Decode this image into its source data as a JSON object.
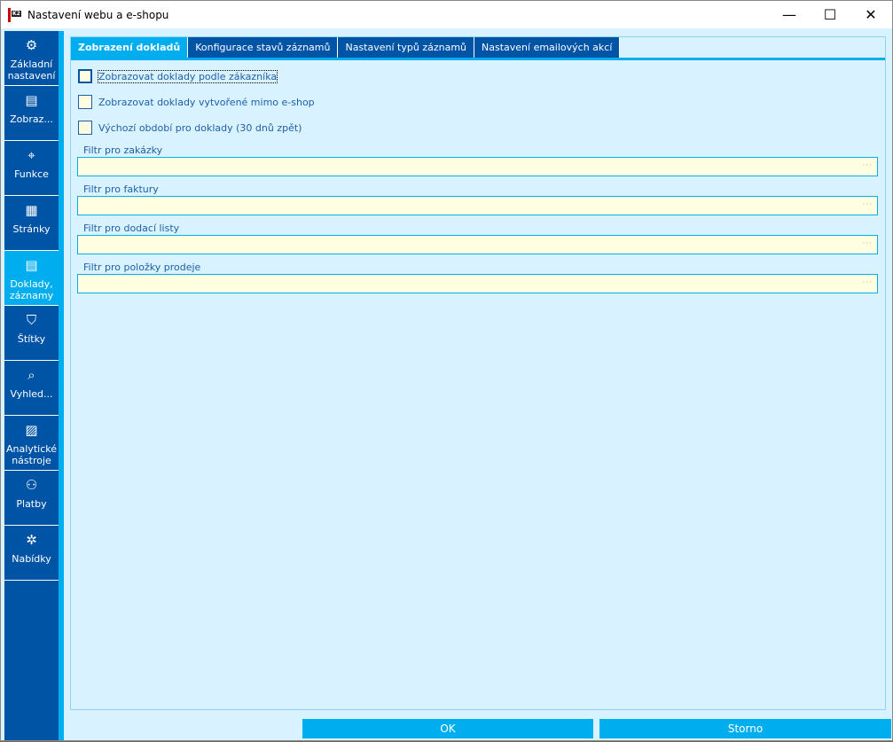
{
  "window": {
    "title": "Nastavení webu a e-shopu",
    "logo_text": "K2",
    "minimize": "—",
    "maximize": "☐",
    "close": "✕"
  },
  "sidebar": {
    "items": [
      {
        "label": "Základní nastavení",
        "icon": "⚙"
      },
      {
        "label": "Zobraz...",
        "icon": "▤"
      },
      {
        "label": "Funkce",
        "icon": "⌖"
      },
      {
        "label": "Stránky",
        "icon": "▦"
      },
      {
        "label": "Doklady, záznamy",
        "icon": "▤"
      },
      {
        "label": "Štítky",
        "icon": "⛉"
      },
      {
        "label": "Vyhled...",
        "icon": "⌕"
      },
      {
        "label": "Analytické nástroje",
        "icon": "▨"
      },
      {
        "label": "Platby",
        "icon": "⚇"
      },
      {
        "label": "Nabídky",
        "icon": "✲"
      }
    ]
  },
  "tabs": [
    "Zobrazení dokladů",
    "Konfigurace stavů záznamů",
    "Nastavení typů záznamů",
    "Nastavení emailových akcí"
  ],
  "checkboxes": [
    "Zobrazovat doklady podle zákazníka",
    "Zobrazovat doklady vytvořené mimo e-shop",
    "Výchozí období pro doklady (30 dnů zpět)"
  ],
  "fields": [
    {
      "label": "Filtr pro zakázky",
      "value": ""
    },
    {
      "label": "Filtr pro faktury",
      "value": ""
    },
    {
      "label": "Filtr pro dodací listy",
      "value": ""
    },
    {
      "label": "Filtr pro položky prodeje",
      "value": ""
    }
  ],
  "ellipsis": "···",
  "buttons": {
    "ok": "OK",
    "cancel": "Storno"
  }
}
